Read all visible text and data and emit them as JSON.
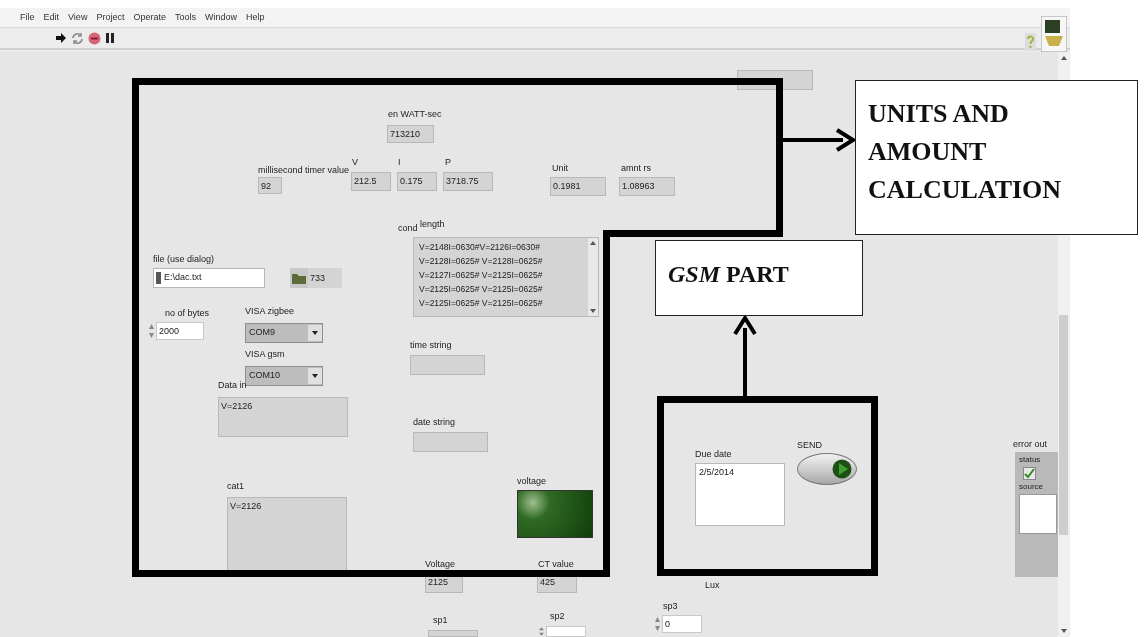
{
  "menu": [
    "File",
    "Edit",
    "View",
    "Project",
    "Operate",
    "Tools",
    "Window",
    "Help"
  ],
  "toolbar": [
    {
      "kind": "run"
    },
    {
      "kind": "run-continuous"
    },
    {
      "kind": "abort"
    },
    {
      "kind": "pause"
    }
  ],
  "controls": [
    {
      "kind": "indicator"
    },
    {
      "kind": "indicator",
      "label": "en WATT-sec",
      "value": "713210"
    },
    {
      "kind": "indicator",
      "label": "millisecond timer value",
      "value": "92"
    },
    {
      "kind": "indicator",
      "label": "V",
      "value": "212.5"
    },
    {
      "kind": "indicator",
      "label": "I",
      "value": "0.175"
    },
    {
      "kind": "indicator",
      "label": "P",
      "value": "3718.75"
    },
    {
      "kind": "indicator",
      "label": "Unit",
      "value": "0.1981"
    },
    {
      "kind": "indicator",
      "label": "amnt rs",
      "value": "1.08963"
    },
    {
      "kind": "listbox",
      "labels": [
        "cond",
        "length"
      ],
      "lines": [
        "V=2148I=0630#V=2126I=0630#",
        "V=2128I=0625# V=2128I=0625#",
        "V=2127I=0625# V=2125I=0625#",
        "V=2125I=0625# V=2125I=0625#",
        "V=2125I=0625# V=2125I=0625#"
      ]
    },
    {
      "kind": "path",
      "label": "file (use dialog)",
      "value": "E:\\dac.txt"
    },
    {
      "kind": "browse",
      "value": "733"
    },
    {
      "kind": "numeric",
      "label": "no of bytes",
      "value": "2000"
    },
    {
      "kind": "dropdown",
      "label": "VISA zigbee",
      "value": "COM9"
    },
    {
      "kind": "dropdown",
      "label": "VISA gsm",
      "value": "COM10"
    },
    {
      "kind": "string",
      "label": "Data in",
      "value": "V=2126"
    },
    {
      "kind": "indicator",
      "label": "time string"
    },
    {
      "kind": "indicator",
      "label": "date string"
    },
    {
      "kind": "string",
      "label": "cat1",
      "value": "V=2126"
    },
    {
      "kind": "led",
      "label": "voltage",
      "on": true
    },
    {
      "kind": "indicator",
      "label": "Voltage",
      "value": "2125"
    },
    {
      "kind": "indicator",
      "label": "CT value",
      "value": "425"
    },
    {
      "kind": "indicator",
      "label": "sp1"
    },
    {
      "kind": "numeric",
      "label": "sp2"
    },
    {
      "kind": "numeric",
      "label": "sp3",
      "value": "0"
    },
    {
      "kind": "label",
      "label": "Lux"
    },
    {
      "kind": "text-control",
      "label": "Due date",
      "value": "2/5/2014"
    },
    {
      "kind": "button",
      "label": "SEND"
    },
    {
      "kind": "cluster",
      "label": "error out",
      "fields": [
        {
          "label": "status",
          "checked": true
        },
        {
          "label": "source"
        }
      ]
    }
  ],
  "annotations": [
    {
      "text": "UNITS AND AMOUNT CALCULATION"
    },
    {
      "text": "*GSM* PART"
    }
  ]
}
